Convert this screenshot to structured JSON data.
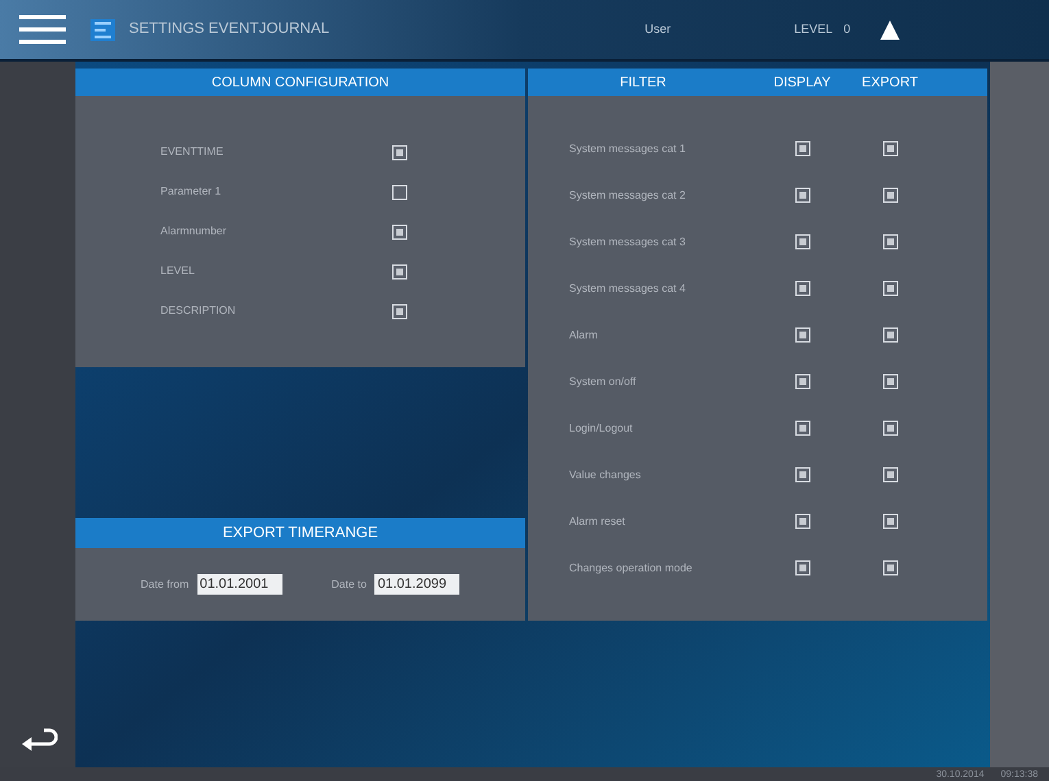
{
  "header": {
    "title": "SETTINGS EVENTJOURNAL",
    "user": "User",
    "level": "LEVEL",
    "level_value": "0"
  },
  "column_configuration": {
    "title": "COLUMN CONFIGURATION",
    "items": [
      {
        "label": "EVENTTIME",
        "checked": true
      },
      {
        "label": "Parameter 1",
        "checked": false
      },
      {
        "label": "Alarmnumber",
        "checked": true
      },
      {
        "label": "LEVEL",
        "checked": true
      },
      {
        "label": "DESCRIPTION",
        "checked": true
      }
    ]
  },
  "export_timerange": {
    "title": "EXPORT TIMERANGE",
    "from_label": "Date from",
    "from_value": "01.01.2001",
    "to_label": "Date to",
    "to_value": "01.01.2099"
  },
  "filter": {
    "columns": [
      "FILTER",
      "DISPLAY",
      "EXPORT"
    ],
    "rows": [
      {
        "label": "System messages cat 1",
        "display": true,
        "export": true
      },
      {
        "label": "System messages cat 2",
        "display": true,
        "export": true
      },
      {
        "label": "System messages cat 3",
        "display": true,
        "export": true
      },
      {
        "label": "System messages cat 4",
        "display": true,
        "export": true
      },
      {
        "label": "Alarm",
        "display": true,
        "export": true
      },
      {
        "label": "System on/off",
        "display": true,
        "export": true
      },
      {
        "label": "Login/Logout",
        "display": true,
        "export": true
      },
      {
        "label": "Value changes",
        "display": true,
        "export": true
      },
      {
        "label": "Alarm reset",
        "display": true,
        "export": true
      },
      {
        "label": "Changes operation mode",
        "display": true,
        "export": true
      }
    ]
  },
  "status_bar": {
    "date": "30.10.2014",
    "time": "09:13:38"
  }
}
